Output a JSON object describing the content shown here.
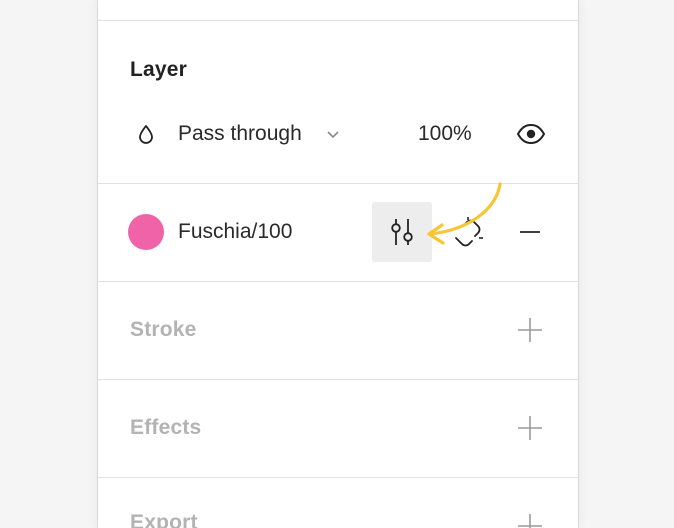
{
  "layer": {
    "title": "Layer",
    "blend_mode": "Pass through",
    "opacity": "100%"
  },
  "fill": {
    "style_name": "Fuschia/100",
    "swatch_color": "#f063a8"
  },
  "sections": {
    "stroke": "Stroke",
    "effects": "Effects",
    "export": "Export"
  },
  "icons": {
    "blend": "drop-icon",
    "dropdown": "chevron-down-icon",
    "visibility": "eye-icon",
    "adjust": "sliders-icon",
    "detach": "detach-style-icon",
    "remove": "minus-icon",
    "add": "plus-icon"
  },
  "colors": {
    "callout_arrow": "#f7c634",
    "adjust_button_bg": "#ededed",
    "muted_title": "#b3b3b3"
  }
}
